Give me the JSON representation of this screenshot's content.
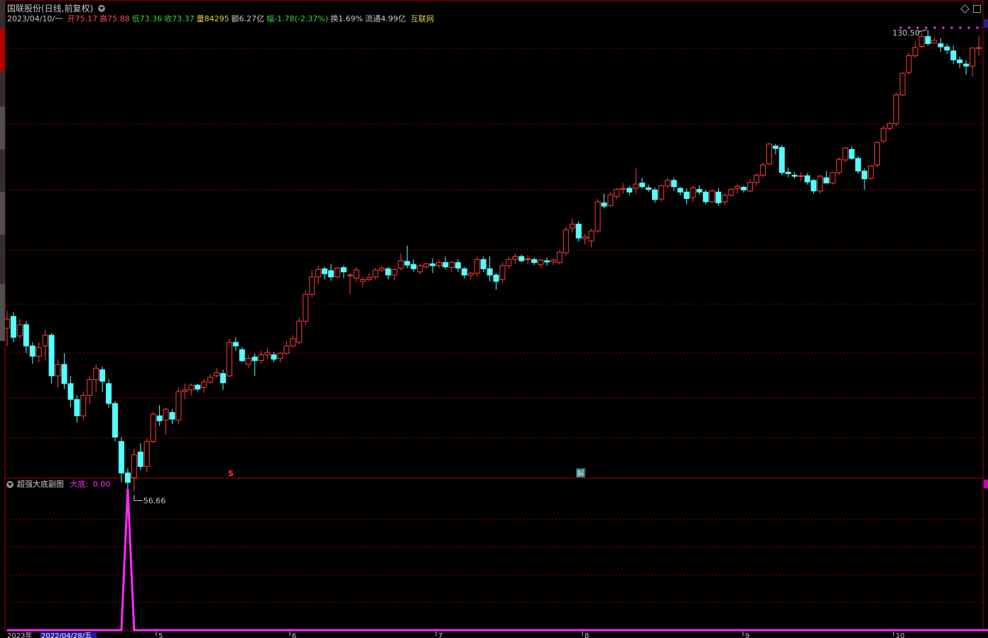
{
  "window": {
    "stock_title": "国联股份(日线,前复权)"
  },
  "quote": {
    "date": "2023/04/10/一",
    "items": [
      {
        "label": "开",
        "value": "75.17",
        "color": "#ff4b4b"
      },
      {
        "label": "高",
        "value": "75.88",
        "color": "#ff4b4b"
      },
      {
        "label": "低",
        "value": "73.36",
        "color": "#3cd23c"
      },
      {
        "label": "收",
        "value": "73.37",
        "color": "#3cd23c"
      },
      {
        "label": "量",
        "value": "84295",
        "color": "#e8d23c"
      },
      {
        "label": "额",
        "value": "6.27亿",
        "color": "#c8c8c8"
      },
      {
        "label": "幅",
        "value": "-1.78(-2.37%)",
        "color": "#3cd23c"
      },
      {
        "label": "换",
        "value": "1.69%",
        "color": "#c8c8c8"
      },
      {
        "label": "流通",
        "value": "4.99亿",
        "color": "#c8c8c8"
      }
    ],
    "sector": "互联网"
  },
  "indicator": {
    "name": "超强大底副图",
    "line_label": "大底:",
    "line_value": "0.00",
    "line_color": "#ff2bff"
  },
  "markers": {
    "high_label": "130.50",
    "low_label": "56.66",
    "event_s": "S",
    "event_jie": "解"
  },
  "bottom_axis": {
    "year_label": "2023年",
    "date_tag": "2022/04/28/五",
    "ticks": [
      "5",
      "6",
      "7",
      "8",
      "9",
      "10"
    ]
  },
  "colors": {
    "background": "#000000",
    "up": "#ff3c3c",
    "down": "#54ffff",
    "grid": "#8b0000",
    "indicator_line": "#ff2bff",
    "text": "#c8c8c8"
  },
  "chart_data": [
    {
      "type": "candlestick",
      "title": "国联股份(日线,前复权)",
      "ylim": [
        56.66,
        130.5
      ],
      "candles": [
        [
          72.5,
          75,
          70,
          73.8
        ],
        [
          74.2,
          74.8,
          70.5,
          71.2
        ],
        [
          71.4,
          73.8,
          71,
          73
        ],
        [
          73,
          73.5,
          69,
          70
        ],
        [
          70,
          70.5,
          67.6,
          68.6
        ],
        [
          68.6,
          70.5,
          67.8,
          69.8
        ],
        [
          70,
          72.3,
          68,
          71.5
        ],
        [
          71.5,
          71.8,
          65,
          66
        ],
        [
          66,
          68.2,
          64.5,
          67.5
        ],
        [
          67.5,
          69,
          64.3,
          65
        ],
        [
          65,
          66,
          62,
          63
        ],
        [
          63,
          63.5,
          60.2,
          61
        ],
        [
          61,
          64,
          60.5,
          63.5
        ],
        [
          63.5,
          66,
          62.4,
          65.5
        ],
        [
          65.5,
          67.5,
          64,
          67
        ],
        [
          66.8,
          67.2,
          63.9,
          65.3
        ],
        [
          65,
          65.6,
          62,
          62.5
        ],
        [
          62.5,
          62.8,
          58,
          58.5
        ],
        [
          58,
          58.5,
          53.5,
          54.5
        ],
        [
          54.5,
          55,
          52.8,
          53.5
        ],
        [
          54,
          57.2,
          52.5,
          56.5
        ],
        [
          56.8,
          57.8,
          54.8,
          55.2
        ],
        [
          55.2,
          58.4,
          54.6,
          58
        ],
        [
          58,
          61.5,
          57.8,
          61.2
        ],
        [
          61,
          62.3,
          59.8,
          60.4
        ],
        [
          60.5,
          62,
          58.8,
          61.8
        ],
        [
          61.4,
          61.8,
          60,
          60.6
        ],
        [
          60.5,
          64.5,
          60,
          64
        ],
        [
          64,
          65,
          63,
          64.2
        ],
        [
          64.2,
          65,
          63.5,
          64.8
        ],
        [
          64.8,
          65,
          64,
          64.3
        ],
        [
          64.5,
          65.6,
          63.8,
          65.2
        ],
        [
          65.2,
          66.2,
          65,
          65.8
        ],
        [
          66,
          67,
          65.8,
          66.4
        ],
        [
          66.3,
          66.8,
          64.2,
          65.1
        ],
        [
          66,
          71,
          65.8,
          70.5
        ],
        [
          70.5,
          71.2,
          69.3,
          70
        ],
        [
          69.5,
          69.8,
          67.8,
          68
        ],
        [
          67.5,
          68.8,
          67,
          68.3
        ],
        [
          68.5,
          69,
          66,
          68
        ],
        [
          68,
          69.3,
          67.6,
          68.8
        ],
        [
          68.8,
          69.8,
          68.2,
          69.1
        ],
        [
          68.8,
          69.2,
          67.8,
          68.2
        ],
        [
          68.3,
          69.2,
          67.8,
          69
        ],
        [
          69,
          70.7,
          68.8,
          70
        ],
        [
          70,
          71.5,
          69.8,
          71
        ],
        [
          70.5,
          74,
          70.3,
          73.5
        ],
        [
          73.5,
          78.2,
          73,
          77.5
        ],
        [
          77.5,
          81.3,
          77,
          80.2
        ],
        [
          80.2,
          82,
          79,
          81.4
        ],
        [
          81.5,
          81.8,
          79.8,
          80.7
        ],
        [
          81.2,
          82.3,
          79.6,
          80.2
        ],
        [
          80.2,
          81.8,
          80,
          81.6
        ],
        [
          81.7,
          82,
          80,
          81
        ],
        [
          80.5,
          80.8,
          77.5,
          80.5
        ],
        [
          80,
          81.8,
          79.4,
          81.3
        ],
        [
          79.5,
          80.2,
          78.6,
          79.8
        ],
        [
          79.8,
          80.8,
          79.5,
          80.1
        ],
        [
          80.2,
          81.6,
          79.8,
          81.3
        ],
        [
          81.3,
          82,
          81,
          81.6
        ],
        [
          81.5,
          81.8,
          79.8,
          80.5
        ],
        [
          80.5,
          81.6,
          79.7,
          81.4
        ],
        [
          81.6,
          84,
          81.2,
          82.8
        ],
        [
          82.7,
          85.3,
          81.6,
          82.1
        ],
        [
          82.2,
          83,
          81,
          81.5
        ],
        [
          81,
          82.3,
          80.6,
          82
        ],
        [
          81.8,
          82.5,
          81.5,
          82.3
        ],
        [
          82.3,
          83.2,
          80.8,
          82
        ],
        [
          82,
          83,
          81.6,
          82.5
        ],
        [
          82.5,
          83.5,
          81.4,
          81.8
        ],
        [
          81.7,
          82.8,
          81,
          82.5
        ],
        [
          82.5,
          83,
          81,
          81.6
        ],
        [
          81.5,
          81.8,
          80,
          80.5
        ],
        [
          80.5,
          81,
          79.8,
          80.8
        ],
        [
          80.8,
          83.5,
          80.2,
          83
        ],
        [
          83,
          83.5,
          81,
          81.5
        ],
        [
          81.5,
          83.5,
          79.5,
          80.5
        ],
        [
          80.5,
          80.8,
          78.2,
          79.5
        ],
        [
          79.8,
          82.5,
          79.2,
          82
        ],
        [
          82,
          83.5,
          81.5,
          83
        ],
        [
          83,
          84,
          82.3,
          83.5
        ],
        [
          83.5,
          83.8,
          82.5,
          82.8
        ],
        [
          83,
          83.7,
          82.2,
          83.1
        ],
        [
          83,
          83.3,
          82.1,
          82.5
        ],
        [
          82.2,
          83.1,
          81.6,
          82.9
        ],
        [
          82.8,
          83.3,
          82,
          82.6
        ],
        [
          82.6,
          83.2,
          82.1,
          82.9
        ],
        [
          82.5,
          84.5,
          82.2,
          84.2
        ],
        [
          84.1,
          88.5,
          83.6,
          88
        ],
        [
          88.3,
          90,
          87.5,
          89
        ],
        [
          89,
          89.5,
          86,
          86.6
        ],
        [
          86.5,
          87.3,
          85.5,
          86.8
        ],
        [
          86.1,
          88.2,
          85,
          87.8
        ],
        [
          87.8,
          93.5,
          87.5,
          93
        ],
        [
          92.8,
          94.5,
          91.8,
          92.2
        ],
        [
          92.3,
          94.8,
          92.1,
          94.3
        ],
        [
          94,
          95.6,
          93.5,
          95.3
        ],
        [
          95.3,
          96.5,
          94.5,
          95.5
        ],
        [
          95.5,
          96,
          94.2,
          94.8
        ],
        [
          95.5,
          99.3,
          94.5,
          96.3
        ],
        [
          96.5,
          97.5,
          95.5,
          95.8
        ],
        [
          95.6,
          96.2,
          94.8,
          95.3
        ],
        [
          95.2,
          95.6,
          92.8,
          93.4
        ],
        [
          93.5,
          96.2,
          93,
          96
        ],
        [
          96,
          97.5,
          95.5,
          97
        ],
        [
          97,
          97.5,
          95,
          95.8
        ],
        [
          95.5,
          95.8,
          94.2,
          94.8
        ],
        [
          94.8,
          95.5,
          92.5,
          93.6
        ],
        [
          93.8,
          96,
          93,
          95.6
        ],
        [
          95.3,
          96.1,
          94.3,
          94.8
        ],
        [
          94.8,
          95.2,
          92.6,
          93
        ],
        [
          93,
          95.3,
          92.8,
          95
        ],
        [
          94.8,
          95.5,
          92.3,
          92.8
        ],
        [
          93,
          94.5,
          92.4,
          94.2
        ],
        [
          94.2,
          95.6,
          94,
          95.3
        ],
        [
          95.4,
          96.2,
          94.5,
          95.9
        ],
        [
          95.7,
          96,
          94.7,
          95.2
        ],
        [
          95,
          97.2,
          94.8,
          96.6
        ],
        [
          96.6,
          98.4,
          96,
          98
        ],
        [
          98,
          100.5,
          97.6,
          100
        ],
        [
          100.2,
          104.5,
          100,
          104.2
        ],
        [
          103.8,
          104.2,
          102.1,
          103.3
        ],
        [
          103.5,
          104,
          98,
          98.5
        ],
        [
          98.6,
          99.5,
          97.6,
          98.3
        ],
        [
          98,
          98.6,
          97.3,
          97.8
        ],
        [
          97.8,
          98.5,
          96.8,
          97.9
        ],
        [
          97.9,
          98.4,
          96.2,
          96.7
        ],
        [
          97,
          97.3,
          94.5,
          95
        ],
        [
          95,
          98.1,
          94.5,
          97.8
        ],
        [
          97.5,
          98.8,
          96.5,
          96.5
        ],
        [
          96.5,
          98.6,
          96.2,
          98.5
        ],
        [
          98.5,
          101.5,
          98,
          101.1
        ],
        [
          101,
          103.6,
          100.6,
          103.4
        ],
        [
          103.1,
          103.8,
          101,
          101.3
        ],
        [
          101.3,
          101.8,
          98.3,
          98.8
        ],
        [
          98.8,
          99.3,
          95.2,
          97.3
        ],
        [
          97.4,
          100,
          97,
          99.8
        ],
        [
          100,
          104.8,
          99.5,
          104.5
        ],
        [
          104.8,
          108,
          104.5,
          107.5
        ],
        [
          107.5,
          108.8,
          107,
          108.5
        ],
        [
          108.5,
          115.3,
          108,
          114.8
        ],
        [
          114.8,
          120,
          114.5,
          119.8
        ],
        [
          120,
          124.8,
          119.5,
          124
        ],
        [
          124,
          127.5,
          123.5,
          126
        ],
        [
          126.3,
          129.8,
          126,
          128.8
        ],
        [
          128.8,
          130.5,
          126.5,
          127
        ],
        [
          127.2,
          128.5,
          127,
          127.8
        ],
        [
          127,
          128.3,
          125,
          126.2
        ],
        [
          126.2,
          127,
          124.4,
          125.4
        ],
        [
          125.2,
          126.5,
          122,
          123
        ],
        [
          123,
          123.8,
          121,
          122.3
        ],
        [
          122,
          122.8,
          119.5,
          121.5
        ],
        [
          121.5,
          126,
          119,
          125.9
        ],
        [
          126,
          129,
          124,
          126
        ]
      ]
    },
    {
      "type": "line",
      "title": "超强大底副图",
      "series": [
        {
          "name": "大底",
          "values": [
            0,
            0,
            0,
            0,
            0,
            0,
            0,
            0,
            0,
            0,
            0,
            0,
            0,
            0,
            0,
            0,
            0,
            0,
            0,
            1,
            0,
            0,
            0,
            0,
            0,
            0,
            0,
            0,
            0,
            0,
            0,
            0,
            0,
            0,
            0,
            0,
            0,
            0,
            0,
            0,
            0,
            0,
            0,
            0,
            0,
            0,
            0,
            0,
            0,
            0,
            0,
            0,
            0,
            0,
            0,
            0,
            0,
            0,
            0,
            0,
            0,
            0,
            0,
            0,
            0,
            0,
            0,
            0,
            0,
            0,
            0,
            0,
            0,
            0,
            0,
            0,
            0,
            0,
            0,
            0,
            0,
            0,
            0,
            0,
            0,
            0,
            0,
            0,
            0,
            0,
            0,
            0,
            0,
            0,
            0,
            0,
            0,
            0,
            0,
            0,
            0,
            0,
            0,
            0,
            0,
            0,
            0,
            0,
            0,
            0,
            0,
            0,
            0,
            0,
            0,
            0,
            0,
            0,
            0,
            0,
            0,
            0,
            0,
            0,
            0,
            0,
            0,
            0,
            0,
            0,
            0,
            0,
            0,
            0,
            0,
            0,
            0,
            0,
            0,
            0,
            0,
            0,
            0,
            0,
            0,
            0,
            0,
            0,
            0,
            0,
            0,
            0,
            0,
            0,
            0,
            0,
            0,
            0,
            0
          ]
        }
      ]
    }
  ]
}
